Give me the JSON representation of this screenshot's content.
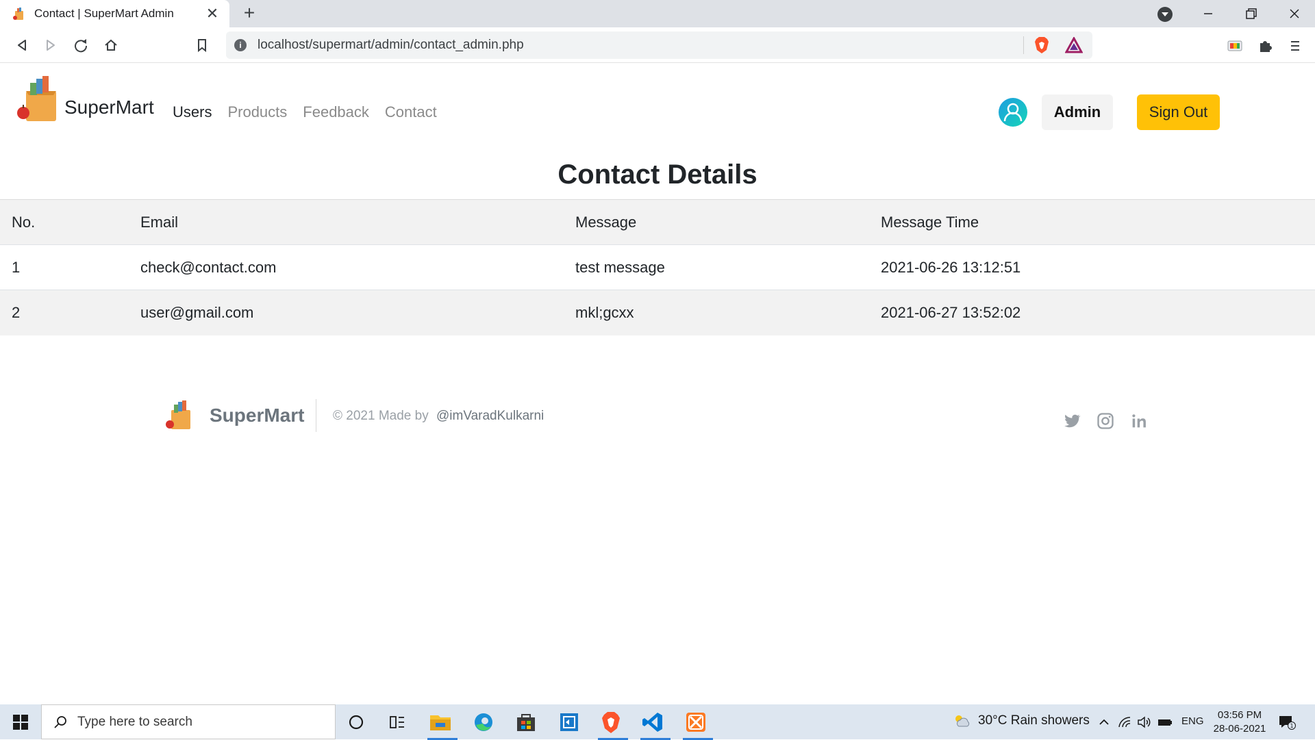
{
  "browser": {
    "tab_title": "Contact | SuperMart Admin",
    "tab_close": "✕",
    "new_tab": "+",
    "url": "localhost/supermart/admin/contact_admin.php",
    "window_controls": [
      "minimize",
      "maximize",
      "close"
    ]
  },
  "nav": {
    "brand": "SuperMart",
    "links": [
      {
        "label": "Users",
        "active": true
      },
      {
        "label": "Products",
        "active": false
      },
      {
        "label": "Feedback",
        "active": false
      },
      {
        "label": "Contact",
        "active": false
      }
    ],
    "admin_label": "Admin",
    "signout_label": "Sign Out"
  },
  "main": {
    "title": "Contact Details",
    "table": {
      "headers": [
        "No.",
        "Email",
        "Message",
        "Message Time"
      ],
      "rows": [
        [
          "1",
          "check@contact.com",
          "test message",
          "2021-06-26 13:12:51"
        ],
        [
          "2",
          "user@gmail.com",
          "mkl;gcxx",
          "2021-06-27 13:52:02"
        ]
      ]
    }
  },
  "footer": {
    "brand": "SuperMart",
    "copyright": "© 2021 Made by",
    "handle": "@imVaradKulkarni",
    "social": [
      "twitter-icon",
      "instagram-icon",
      "linkedin-icon"
    ]
  },
  "taskbar": {
    "search_placeholder": "Type here to search",
    "weather": "30°C  Rain showers",
    "language": "ENG",
    "time": "03:56 PM",
    "date": "28-06-2021",
    "notification_count": "1"
  },
  "colors": {
    "accent": "#ffc107",
    "table_stripe": "#f2f2f2",
    "avatar_start": "#1e9de0",
    "avatar_end": "#15d4b8"
  }
}
